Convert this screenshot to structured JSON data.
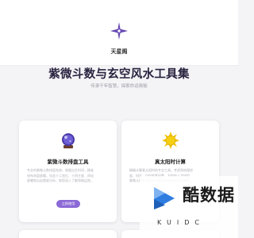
{
  "site": {
    "name": "天星阁",
    "logo_icon": "four-point-star-icon"
  },
  "hero": {
    "title": "紫微斗数与玄空风水工具集",
    "subtitle": "传承千年智慧，探索命运奥秘"
  },
  "tools": [
    {
      "icon": "crystal-ball-icon",
      "title": "紫微斗数排盘工具",
      "description": "专业的紫微斗数排盘系统，根据出生时间，精准\n排布命盘星曜，包含十二宫位、十四主星、四化\n星曜和吉凶煞星分析，助您深入了解命格运势。",
      "button_label": "立即使用"
    },
    {
      "icon": "sun-icon",
      "title": "真太阳时计算",
      "description": "精确计算真太阳时的专业工具，考虑到地理经\n度、时区、均时差等因素，为您的八字排盘、\n紫微斗数等命理分析提供最准确的时间基础。"
    }
  ],
  "watermark": {
    "text": "酷数据",
    "subtext": "KUIDC"
  },
  "colors": {
    "accent": "#8b6ad6",
    "background": "#f4f4f6",
    "title": "#2a2340",
    "star": "#5b3da8",
    "sun": "#f2c200",
    "watermark_blue": "#2f7de1"
  }
}
